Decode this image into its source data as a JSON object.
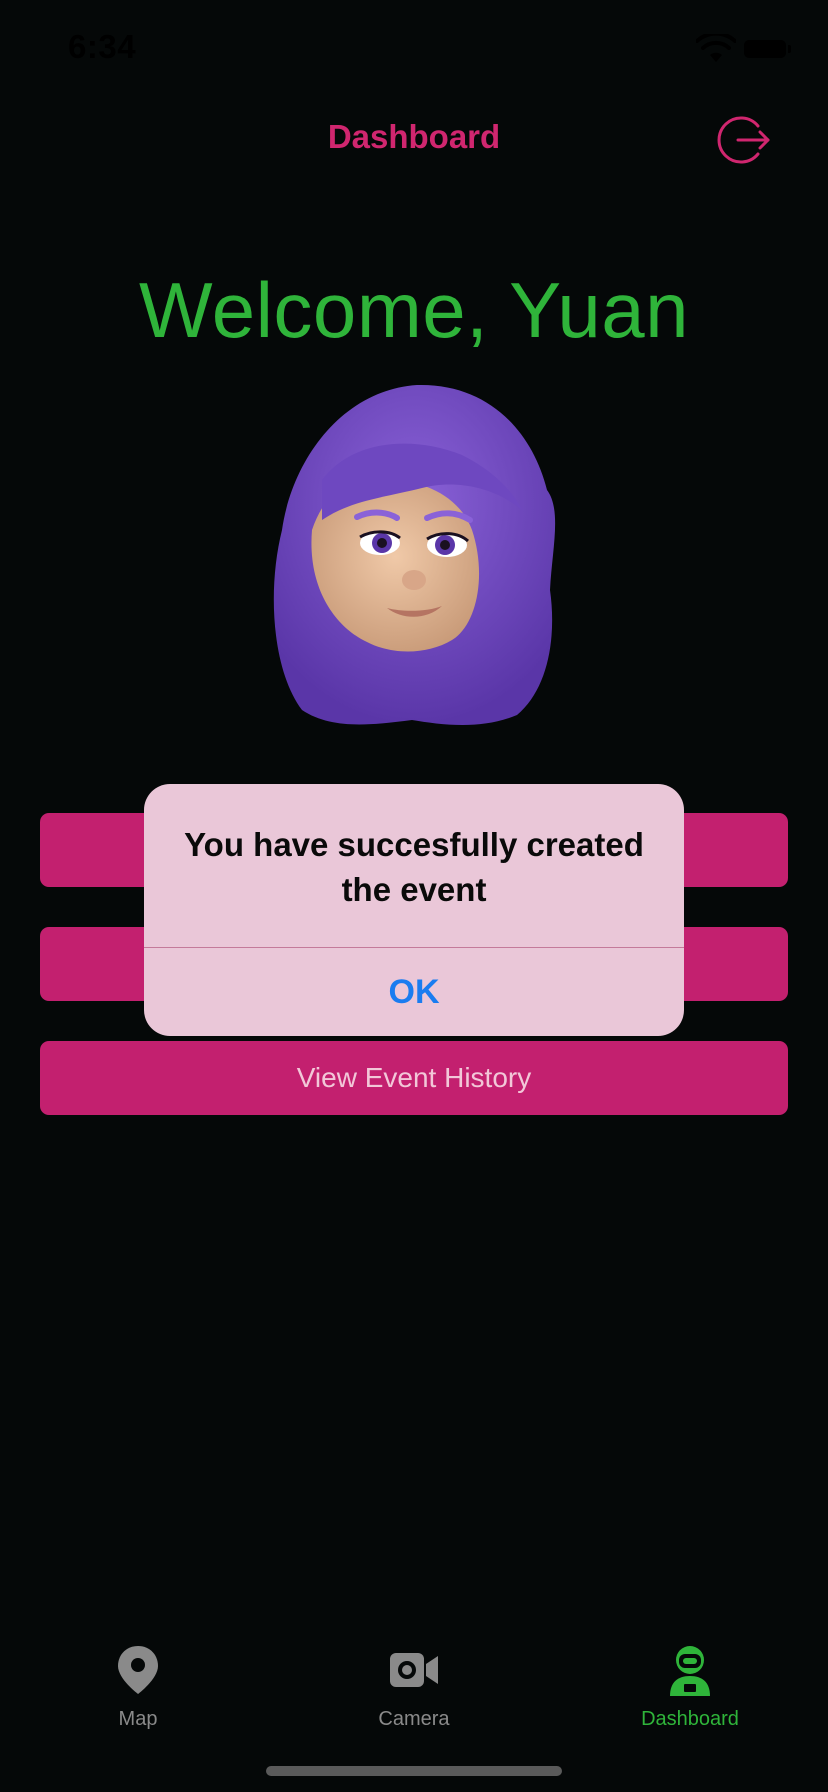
{
  "status_bar": {
    "time": "6:34",
    "icons": [
      "wifi-icon",
      "battery-icon"
    ]
  },
  "nav": {
    "title": "Dashboard",
    "logout_icon": "logout-icon"
  },
  "welcome": {
    "text": "Welcome, Yuan",
    "avatar": "memoji-avatar-purple-hair"
  },
  "buttons": [
    {
      "label": ""
    },
    {
      "label": ""
    },
    {
      "label": "View Event History"
    }
  ],
  "alert": {
    "message": "You have succesfully created the event",
    "ok_label": "OK"
  },
  "tab_bar": {
    "tabs": [
      {
        "label": "Map",
        "icon": "map-pin-icon",
        "selected": false
      },
      {
        "label": "Camera",
        "icon": "video-camera-icon",
        "selected": false
      },
      {
        "label": "Dashboard",
        "icon": "astronaut-icon",
        "selected": true
      }
    ]
  },
  "colors": {
    "background": "#050808",
    "accent_pink": "#c3206f",
    "title_pink": "#d0266f",
    "welcome_green": "#2fb43a",
    "alert_background": "#eac7d8",
    "alert_button_blue": "#1a7cf0",
    "tab_inactive": "#8a8a8a"
  }
}
